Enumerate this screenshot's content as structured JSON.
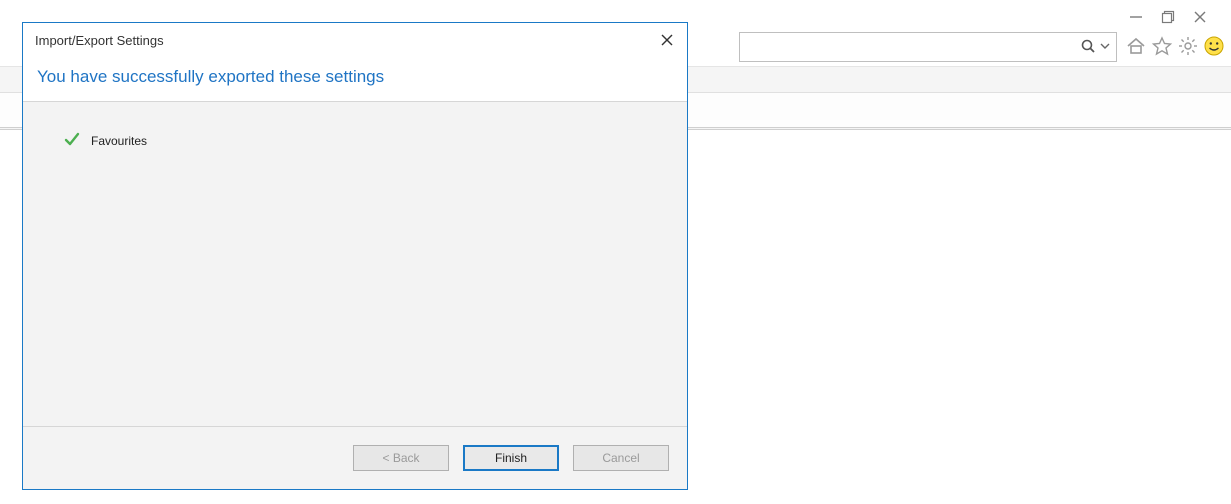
{
  "window_controls": {
    "minimize": "Minimize",
    "maximize": "Restore",
    "close": "Close"
  },
  "toolbar": {
    "search_placeholder": "",
    "icons": {
      "search": "search-icon",
      "dropdown": "chevron-down-icon",
      "home": "home-icon",
      "favorites": "star-icon",
      "tools": "gear-icon",
      "smiley": "smiley-icon"
    }
  },
  "dialog": {
    "title": "Import/Export Settings",
    "heading": "You have successfully exported these settings",
    "items": [
      {
        "label": "Favourites",
        "status": "success"
      }
    ],
    "buttons": {
      "back": "< Back",
      "finish": "Finish",
      "cancel": "Cancel"
    }
  }
}
